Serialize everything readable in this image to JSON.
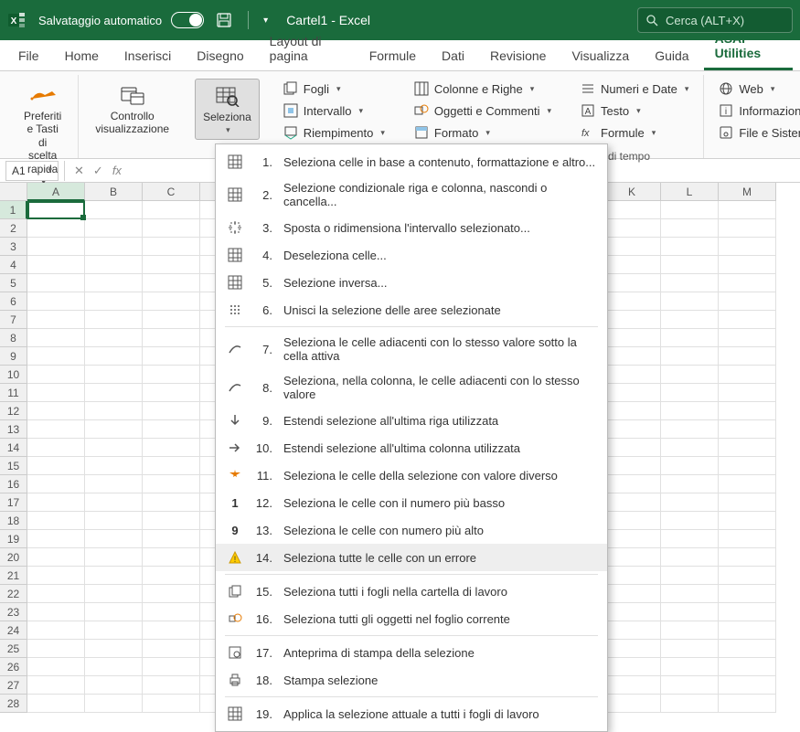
{
  "title_bar": {
    "autosave_label": "Salvataggio automatico",
    "doc_title": "Cartel1 - Excel",
    "search_placeholder": "Cerca (ALT+X)"
  },
  "tabs": {
    "items": [
      "File",
      "Home",
      "Inserisci",
      "Disegno",
      "Layout di pagina",
      "Formule",
      "Dati",
      "Revisione",
      "Visualizza",
      "Guida",
      "ASAP Utilities"
    ],
    "active": "ASAP Utilities"
  },
  "ribbon": {
    "group1": {
      "btn1": "Preferiti e Tasti di\nscelta rapida",
      "label": "Preferiti"
    },
    "group2": {
      "btn1": "Controllo\nvisualizzazione"
    },
    "group3": {
      "btn1": "Seleziona"
    },
    "group4": {
      "fogli": "Fogli",
      "intervallo": "Intervallo",
      "riempimento": "Riempimento"
    },
    "group5": {
      "colonne": "Colonne e Righe",
      "oggetti": "Oggetti e Commenti",
      "formato": "Formato"
    },
    "group6": {
      "numeri": "Numeri e Date",
      "testo": "Testo",
      "formule": "Formule"
    },
    "group7": {
      "web": "Web",
      "info": "Informazioni",
      "file": "File e Sistema"
    },
    "right_text": "di tempo"
  },
  "namebox": "A1",
  "columns_visible": [
    "A",
    "B",
    "C",
    "",
    "",
    "",
    "",
    "K",
    "L",
    "M"
  ],
  "menu": [
    {
      "num": "1.",
      "label": "Seleziona celle in base a contenuto, formattazione e altro...",
      "icon": "grid"
    },
    {
      "num": "2.",
      "label": "Selezione condizionale riga e colonna, nascondi o cancella...",
      "icon": "grid"
    },
    {
      "num": "3.",
      "label": "Sposta o ridimensiona l'intervallo selezionato...",
      "icon": "resize"
    },
    {
      "num": "4.",
      "label": "Deseleziona celle...",
      "icon": "grid"
    },
    {
      "num": "5.",
      "label": "Selezione inversa...",
      "icon": "grid"
    },
    {
      "num": "6.",
      "label": "Unisci la selezione delle aree selezionate",
      "icon": "dots"
    },
    {
      "sep": true
    },
    {
      "num": "7.",
      "label": "Seleziona le celle adiacenti con lo stesso valore sotto la cella attiva",
      "icon": "curve"
    },
    {
      "num": "8.",
      "label": "Seleziona, nella colonna, le celle adiacenti con lo stesso valore",
      "icon": "curve"
    },
    {
      "num": "9.",
      "label": "Estendi selezione all'ultima riga utilizzata",
      "icon": "down"
    },
    {
      "num": "10.",
      "label": "Estendi selezione all'ultima colonna utilizzata",
      "icon": "right"
    },
    {
      "num": "11.",
      "label": "Seleziona le celle della selezione con valore diverso",
      "icon": "star"
    },
    {
      "num": "12.",
      "label": "Seleziona le celle con il numero più basso",
      "icon": "one"
    },
    {
      "num": "13.",
      "label": "Seleziona le celle con numero più alto",
      "icon": "nine"
    },
    {
      "num": "14.",
      "label": "Seleziona tutte le celle con un errore",
      "icon": "warn",
      "hover": true
    },
    {
      "sep": true
    },
    {
      "num": "15.",
      "label": "Seleziona tutti i fogli nella cartella di lavoro",
      "icon": "sheets"
    },
    {
      "num": "16.",
      "label": "Seleziona tutti gli oggetti nel foglio corrente",
      "icon": "objects"
    },
    {
      "sep": true
    },
    {
      "num": "17.",
      "label": "Anteprima di stampa della selezione",
      "icon": "preview"
    },
    {
      "num": "18.",
      "label": "Stampa selezione",
      "icon": "print"
    },
    {
      "sep": true
    },
    {
      "num": "19.",
      "label": "Applica la selezione attuale a tutti i fogli di lavoro",
      "icon": "grid"
    }
  ]
}
